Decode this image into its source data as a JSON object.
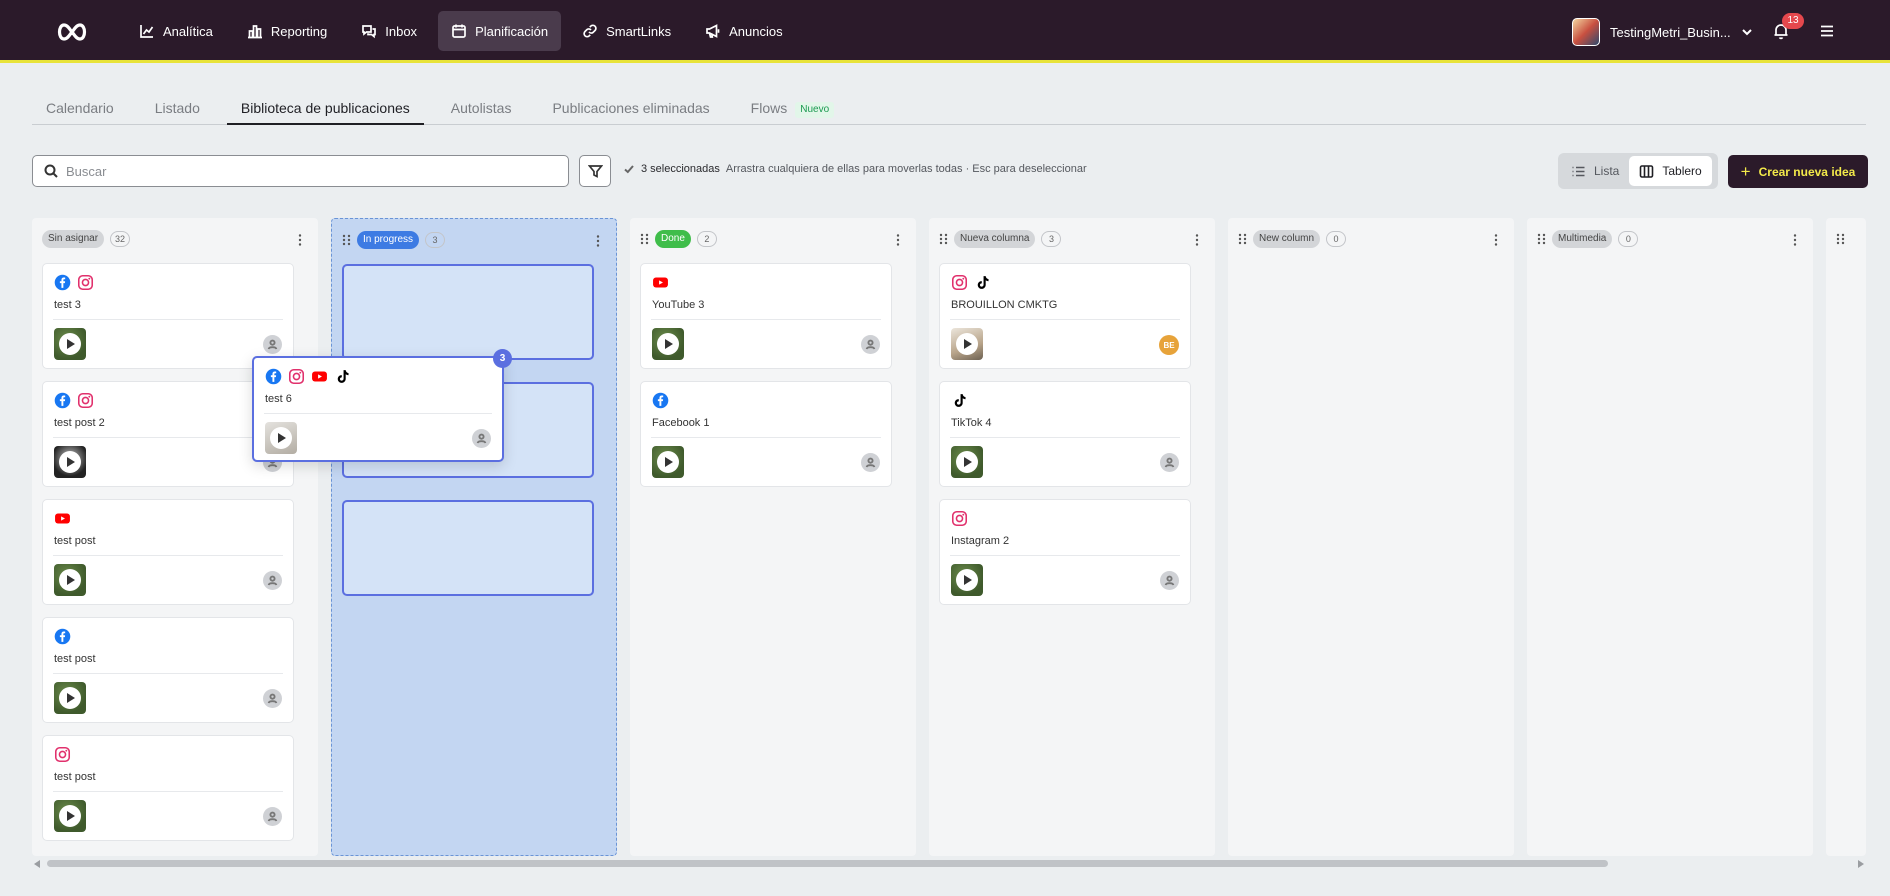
{
  "nav": {
    "items": [
      {
        "label": "Analítica",
        "icon": "chart-line-icon"
      },
      {
        "label": "Reporting",
        "icon": "bar-chart-icon"
      },
      {
        "label": "Inbox",
        "icon": "chat-bubbles-icon"
      },
      {
        "label": "Planificación",
        "icon": "calendar-icon",
        "active": true
      },
      {
        "label": "SmartLinks",
        "icon": "link-icon"
      },
      {
        "label": "Anuncios",
        "icon": "megaphone-icon"
      }
    ],
    "account_name": "TestingMetri_Busin...",
    "notification_count": "13",
    "colors": {
      "topbar": "#2b1a2a",
      "accent": "#e8e33a"
    }
  },
  "tabs": [
    {
      "label": "Calendario"
    },
    {
      "label": "Listado"
    },
    {
      "label": "Biblioteca de publicaciones",
      "active": true
    },
    {
      "label": "Autolistas"
    },
    {
      "label": "Publicaciones eliminadas"
    },
    {
      "label": "Flows",
      "badge": "Nuevo"
    }
  ],
  "toolbar": {
    "search_placeholder": "Buscar",
    "selected_text": "3 seleccionadas",
    "hint_text": "Arrastra cualquiera de ellas para moverlas todas · Esc para deseleccionar",
    "view_list_label": "Lista",
    "view_board_label": "Tablero",
    "create_label": "Crear nueva idea"
  },
  "columns": [
    {
      "label": "Sin asignar",
      "count": "32",
      "style": "gray",
      "handle": false,
      "cards": [
        {
          "title": "test  3",
          "icons": [
            "facebook",
            "instagram"
          ],
          "thumb": "green",
          "user": "placeholder"
        },
        {
          "title": "test post 2",
          "icons": [
            "facebook",
            "instagram"
          ],
          "thumb": "bw",
          "user": "placeholder"
        },
        {
          "title": "test post",
          "icons": [
            "youtube"
          ],
          "thumb": "green",
          "user": "placeholder"
        },
        {
          "title": "test post",
          "icons": [
            "facebook"
          ],
          "thumb": "green",
          "user": "placeholder"
        },
        {
          "title": "test post",
          "icons": [
            "instagram"
          ],
          "thumb": "green",
          "user": "placeholder"
        }
      ]
    },
    {
      "label": "In progress",
      "count": "3",
      "style": "blue",
      "handle": true,
      "dragover": true,
      "placeholders": 3,
      "cards": []
    },
    {
      "label": "Done",
      "count": "2",
      "style": "green",
      "handle": true,
      "cards": [
        {
          "title": "YouTube 3",
          "icons": [
            "youtube"
          ],
          "thumb": "green",
          "user": "placeholder"
        },
        {
          "title": "Facebook 1",
          "icons": [
            "facebook"
          ],
          "thumb": "green",
          "user": "placeholder"
        }
      ]
    },
    {
      "label": "Nueva columna",
      "count": "3",
      "style": "gray",
      "handle": true,
      "cards": [
        {
          "title": "BROUILLON CMKTG",
          "icons": [
            "instagram",
            "tiktok"
          ],
          "thumb": "person",
          "user": "initials",
          "initials": "BE"
        },
        {
          "title": "TikTok 4",
          "icons": [
            "tiktok"
          ],
          "thumb": "green",
          "user": "placeholder"
        },
        {
          "title": "Instagram 2",
          "icons": [
            "instagram"
          ],
          "thumb": "green",
          "user": "placeholder"
        }
      ]
    },
    {
      "label": "New column",
      "count": "0",
      "style": "gray",
      "handle": true,
      "cards": []
    },
    {
      "label": "Multimedia",
      "count": "0",
      "style": "gray",
      "handle": true,
      "cards": []
    },
    {
      "label": "",
      "count": "",
      "style": "gray",
      "handle": true,
      "partial": true,
      "cards": []
    }
  ],
  "drag_preview": {
    "title": "test 6",
    "icons": [
      "facebook",
      "instagram",
      "youtube",
      "tiktok"
    ],
    "thumb": "light",
    "count": "3"
  },
  "icon_colors": {
    "facebook": "#1877f2",
    "instagram": "#e1306c",
    "youtube": "#ff0000",
    "tiktok": "#000000"
  }
}
